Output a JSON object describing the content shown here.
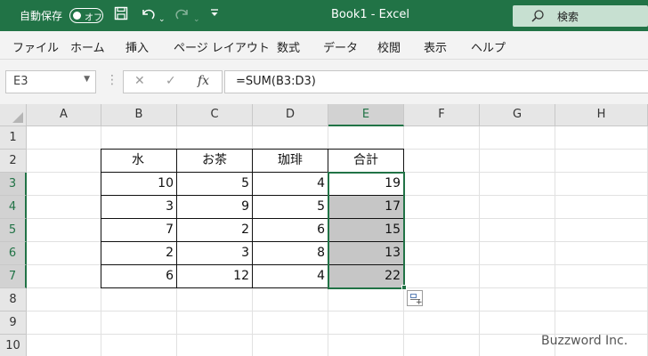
{
  "titlebar": {
    "autosave_label": "自動保存",
    "toggle_label": "オフ",
    "title": "Book1  -  Excel",
    "search_placeholder": "検索"
  },
  "menu": [
    "ファイル",
    "ホーム",
    "挿入",
    "ページ レイアウト",
    "数式",
    "データ",
    "校閲",
    "表示",
    "ヘルプ"
  ],
  "formula_bar": {
    "name_box": "E3",
    "fx_label": "fx",
    "formula": "=SUM(B3:D3)"
  },
  "sheet": {
    "columns": [
      "A",
      "B",
      "C",
      "D",
      "E",
      "F",
      "G",
      "H"
    ],
    "rows": [
      "1",
      "2",
      "3",
      "4",
      "5",
      "6",
      "7",
      "8",
      "9",
      "10"
    ],
    "selected_column": "E",
    "headers": [
      "水",
      "お茶",
      "珈琲",
      "合計"
    ],
    "data": [
      [
        "10",
        "5",
        "4",
        "19"
      ],
      [
        "3",
        "9",
        "5",
        "17"
      ],
      [
        "7",
        "2",
        "6",
        "15"
      ],
      [
        "2",
        "3",
        "8",
        "13"
      ],
      [
        "6",
        "12",
        "4",
        "22"
      ]
    ]
  },
  "watermark": "Buzzword Inc.",
  "colors": {
    "excel_green": "#217346",
    "selection_fill": "#c6c6c6"
  }
}
